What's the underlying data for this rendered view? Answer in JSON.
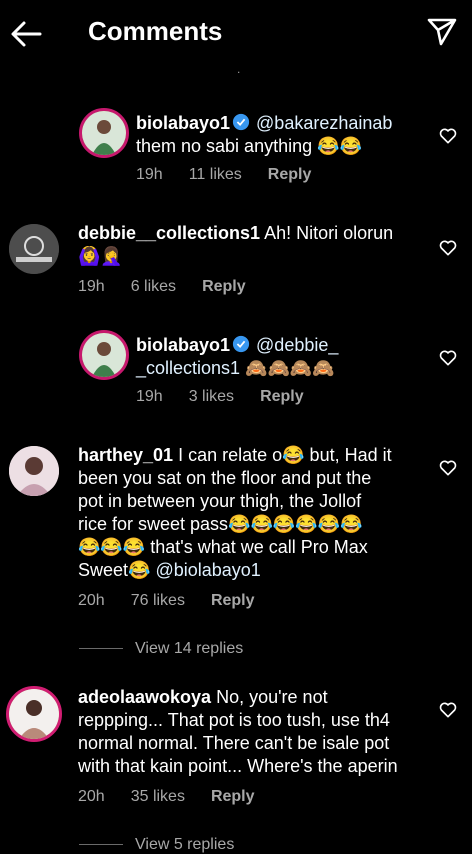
{
  "header": {
    "title": "Comments"
  },
  "top_stub": ".",
  "comments": [
    {
      "username": "biolabayo1",
      "verified": true,
      "mention": "@bakarezhainab",
      "text": "them no sabi anything 😂😂",
      "time": "19h",
      "likes": "11 likes",
      "reply": "Reply"
    },
    {
      "username": "debbie__collections1",
      "text": "Ah! Nitori olorun",
      "text_line2": "🙆‍♀️🤦‍♀️",
      "time": "19h",
      "likes": "6 likes",
      "reply": "Reply"
    },
    {
      "username": "biolabayo1",
      "verified": true,
      "mention": "@debbie_",
      "mention2": "_collections1",
      "text": "🙈🙈🙈🙈",
      "time": "19h",
      "likes": "3 likes",
      "reply": "Reply"
    },
    {
      "username": "harthey_01",
      "text": "I can relate o😂 but, Had it",
      "lines": [
        "been you sat on the floor and put the",
        "pot in between your thigh, the Jollof",
        "rice for sweet pass😂😂😂😂😂😂",
        "😂😂😂 that's what we call Pro Max"
      ],
      "last_line_text": "Sweet😂",
      "last_line_mention": "@biolabayo1",
      "time": "20h",
      "likes": "76 likes",
      "reply": "Reply",
      "view_replies": "View 14 replies"
    },
    {
      "username": "adeolaawokoya",
      "text": "No, you're not",
      "lines": [
        "reppping... That pot is too tush, use th4",
        "normal normal. There can't be isale pot",
        "with that kain point... Where's the aperin"
      ],
      "time": "20h",
      "likes": "35 likes",
      "reply": "Reply",
      "view_replies": "View 5 replies"
    }
  ]
}
